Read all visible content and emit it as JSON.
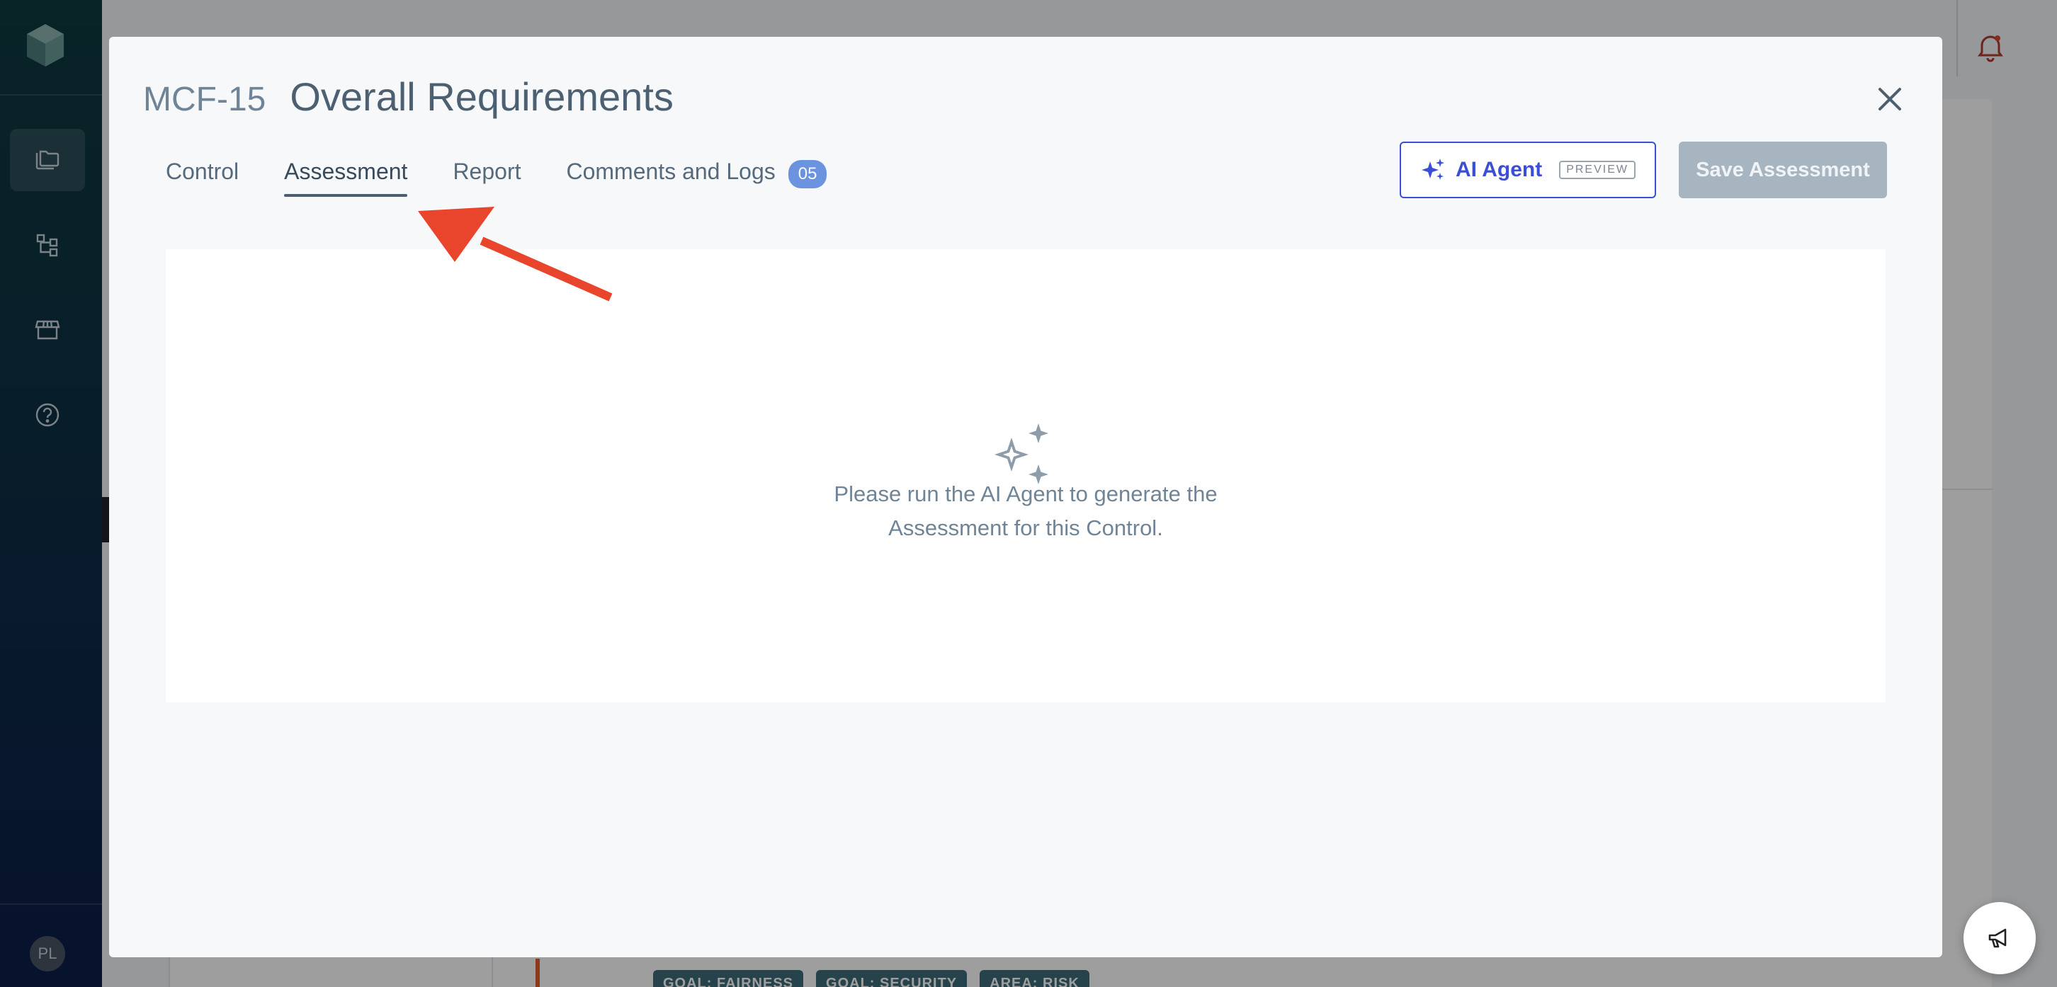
{
  "sidebar": {
    "avatar_initials": "PL",
    "nav_items": [
      {
        "icon": "folders-icon",
        "active": true
      },
      {
        "icon": "hierarchy-icon",
        "active": false
      },
      {
        "icon": "store-icon",
        "active": false
      },
      {
        "icon": "help-icon",
        "active": false
      }
    ]
  },
  "background": {
    "tags": [
      "GOAL: FAIRNESS",
      "GOAL: SECURITY",
      "AREA: RISK"
    ]
  },
  "modal": {
    "code": "MCF-15",
    "title": "Overall Requirements",
    "tabs": [
      {
        "label": "Control",
        "active": false
      },
      {
        "label": "Assessment",
        "active": true
      },
      {
        "label": "Report",
        "active": false
      },
      {
        "label": "Comments and Logs",
        "active": false,
        "badge": "05"
      }
    ],
    "ai_agent": {
      "label": "AI Agent",
      "tag": "PREVIEW"
    },
    "save_label": "Save Assessment",
    "empty_state": {
      "icon": "sparkles-icon",
      "line1": "Please run the AI Agent to generate the",
      "line2": "Assessment for this Control."
    }
  },
  "colors": {
    "accent": "#3b4fd6",
    "badge": "#6b93e0",
    "annotation_arrow": "#e8452c",
    "save_disabled": "#a6b5c0"
  }
}
